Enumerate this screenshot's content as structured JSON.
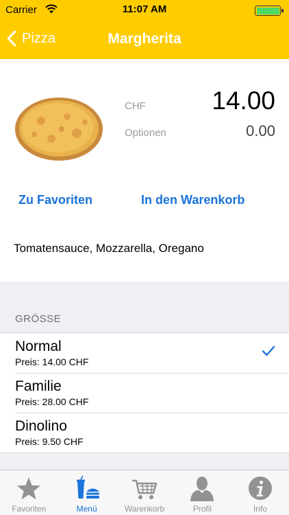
{
  "status_bar": {
    "carrier": "Carrier",
    "time": "11:07 AM",
    "wifi_icon": "wifi-icon",
    "battery_icon": "battery-icon",
    "battery_color": "#4cd964"
  },
  "nav": {
    "back_label": "Pizza",
    "title": "Margherita",
    "bar_color": "#ffcc00"
  },
  "product": {
    "image": "pizza-image",
    "currency_label": "CHF",
    "price": "14.00",
    "options_label": "Optionen",
    "options_price": "0.00",
    "favorites_action": "Zu Favoriten",
    "cart_action": "In den Warenkorb",
    "description": "Tomatensauce, Mozzarella, Oregano",
    "accent_color": "#1a73d9"
  },
  "size_section": {
    "header": "GRÖSSE",
    "options": [
      {
        "name": "Normal",
        "price": "Preis: 14.00 CHF",
        "selected": true
      },
      {
        "name": "Familie",
        "price": "Preis: 28.00 CHF",
        "selected": false
      },
      {
        "name": "Dinolino",
        "price": "Preis: 9.50 CHF",
        "selected": false
      }
    ]
  },
  "tabbar": {
    "tabs": [
      {
        "label": "Favoriten",
        "icon": "star-icon",
        "active": false
      },
      {
        "label": "Menü",
        "icon": "menu-food-icon",
        "active": true
      },
      {
        "label": "Warenkorb",
        "icon": "cart-icon",
        "active": false
      },
      {
        "label": "Profil",
        "icon": "profile-icon",
        "active": false
      },
      {
        "label": "Info",
        "icon": "info-icon",
        "active": false
      }
    ]
  }
}
